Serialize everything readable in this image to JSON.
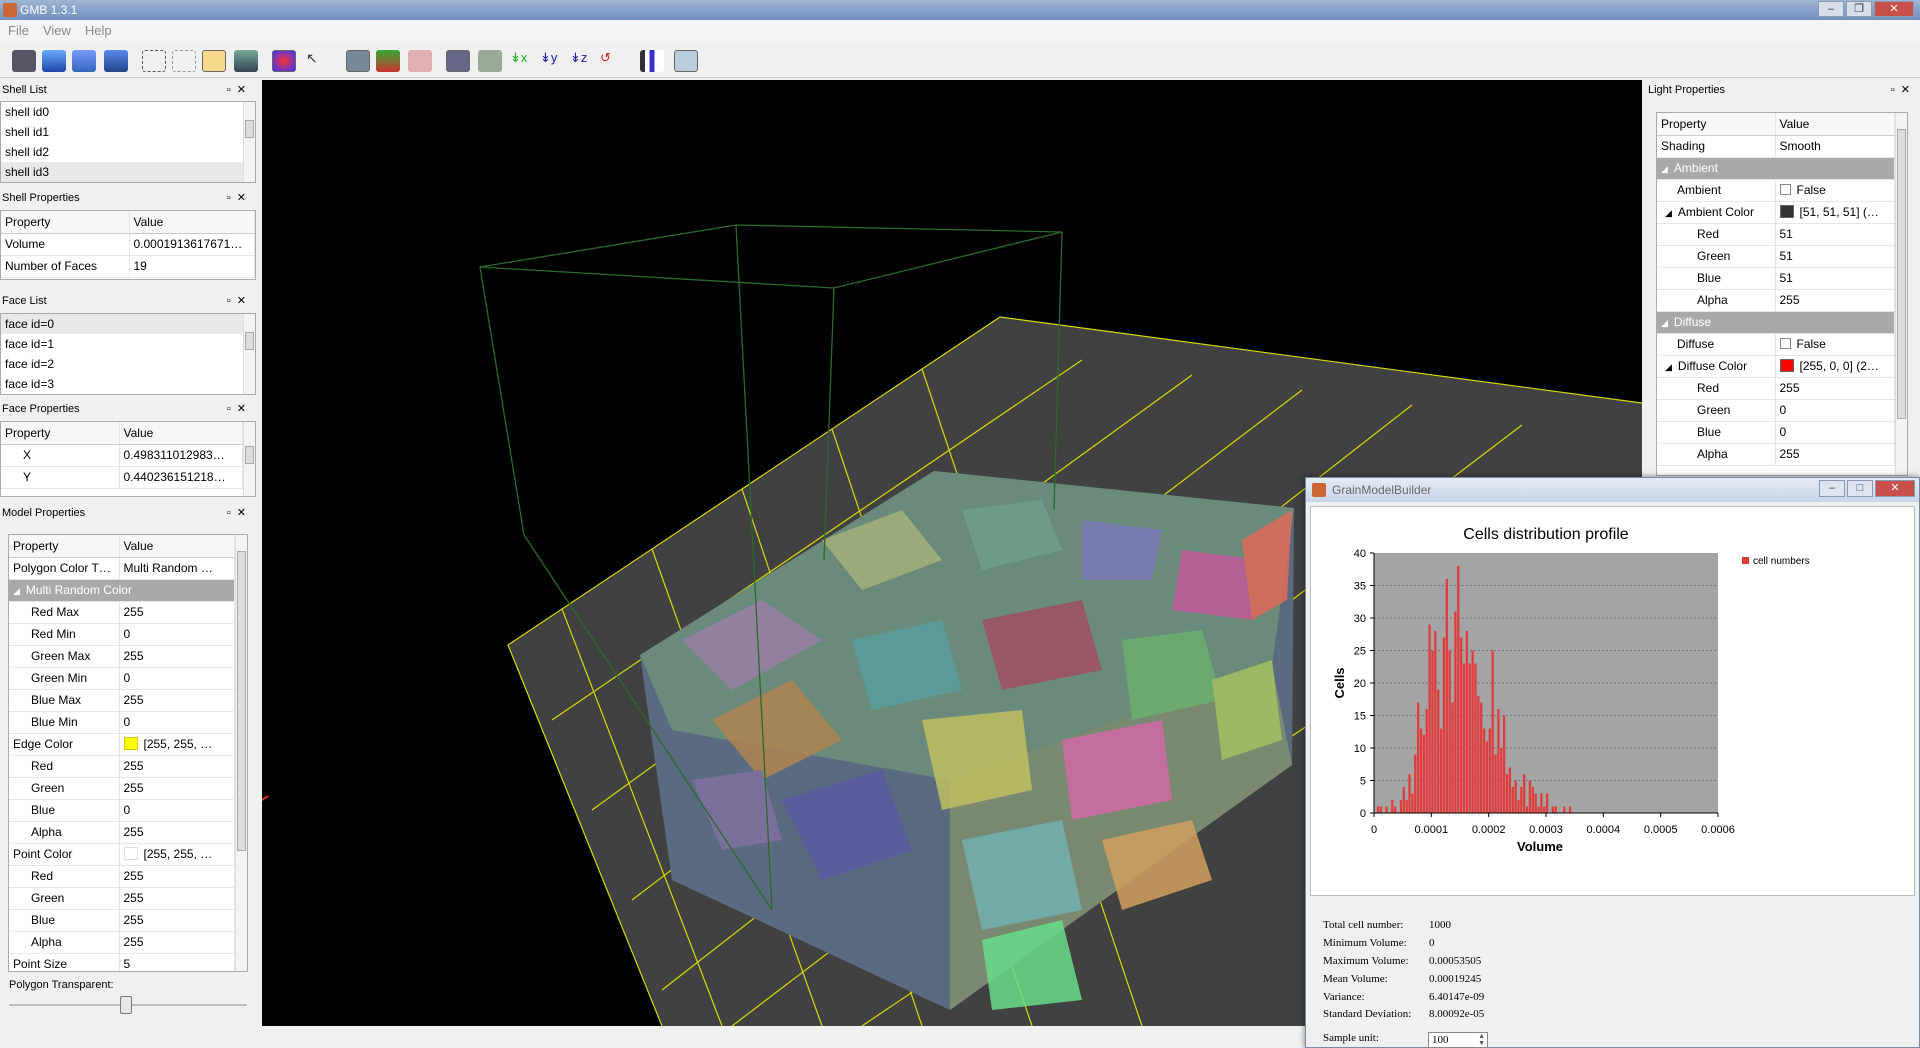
{
  "app": {
    "title": "GMB 1.3.1"
  },
  "menu": [
    "File",
    "View",
    "Help"
  ],
  "shell_list": {
    "title": "Shell List",
    "items": [
      "shell id0",
      "shell id1",
      "shell id2",
      "shell id3"
    ]
  },
  "shell_props": {
    "title": "Shell Properties",
    "header": [
      "Property",
      "Value"
    ],
    "rows": [
      [
        "Volume",
        "0.0001913617671…"
      ],
      [
        "Number of Faces",
        "19"
      ]
    ]
  },
  "face_list": {
    "title": "Face List",
    "items": [
      "face id=0",
      "face id=1",
      "face id=2",
      "face id=3"
    ]
  },
  "face_props": {
    "title": "Face Properties",
    "header": [
      "Property",
      "Value"
    ],
    "rows": [
      [
        "X",
        "0.498311012983…"
      ],
      [
        "Y",
        "0.440236151218…"
      ]
    ]
  },
  "model_props": {
    "title": "Model Properties",
    "header": [
      "Property",
      "Value"
    ],
    "polygon_color_label": "Polygon Color T…",
    "polygon_color_value": "Multi Random …",
    "group": "Multi Random Color",
    "rows": [
      [
        "Red Max",
        "255"
      ],
      [
        "Red Min",
        "0"
      ],
      [
        "Green Max",
        "255"
      ],
      [
        "Green Min",
        "0"
      ],
      [
        "Blue Max",
        "255"
      ],
      [
        "Blue Min",
        "0"
      ]
    ],
    "edge_color_label": "Edge Color",
    "edge_color_value": "[255, 255, …",
    "edge_color_hex": "#ffff00",
    "edge_rows": [
      [
        "Red",
        "255"
      ],
      [
        "Green",
        "255"
      ],
      [
        "Blue",
        "0"
      ],
      [
        "Alpha",
        "255"
      ]
    ],
    "point_color_label": "Point Color",
    "point_color_value": "[255, 255, …",
    "point_rows": [
      [
        "Red",
        "255"
      ],
      [
        "Green",
        "255"
      ],
      [
        "Blue",
        "255"
      ],
      [
        "Alpha",
        "255"
      ]
    ],
    "point_size_label": "Point Size",
    "point_size_value": "5",
    "slider_label": "Polygon Transparent:"
  },
  "light_props": {
    "title": "Light Properties",
    "header": [
      "Property",
      "Value"
    ],
    "shading_label": "Shading",
    "shading_value": "Smooth",
    "ambient_group": "Ambient",
    "ambient_label": "Ambient",
    "ambient_value": "False",
    "ambient_color_label": "Ambient Color",
    "ambient_color_value": "[51, 51, 51] (…",
    "ambient_hex": "#333333",
    "ambient_rows": [
      [
        "Red",
        "51"
      ],
      [
        "Green",
        "51"
      ],
      [
        "Blue",
        "51"
      ],
      [
        "Alpha",
        "255"
      ]
    ],
    "diffuse_group": "Diffuse",
    "diffuse_label": "Diffuse",
    "diffuse_value": "False",
    "diffuse_color_label": "Diffuse Color",
    "diffuse_color_value": "[255, 0, 0] (2…",
    "diffuse_hex": "#ff0000",
    "diffuse_rows": [
      [
        "Red",
        "255"
      ],
      [
        "Green",
        "0"
      ],
      [
        "Blue",
        "0"
      ],
      [
        "Alpha",
        "255"
      ]
    ]
  },
  "dialog": {
    "title": "GrainModelBuilder",
    "stats": [
      [
        "Total cell number:",
        "1000"
      ],
      [
        "Minimum Volume:",
        "0"
      ],
      [
        "Maximum Volume:",
        "0.00053505"
      ],
      [
        "Mean Volume:",
        "0.00019245"
      ],
      [
        "Variance:",
        "6.40147e-09"
      ],
      [
        "Standard Deviation:",
        "8.00092e-05"
      ]
    ],
    "sample_label": "Sample unit:",
    "sample_value": "100"
  },
  "chart_data": {
    "type": "bar",
    "title": "Cells distribution profile",
    "xlabel": "Volume",
    "ylabel": "Cells",
    "xlim": [
      0,
      0.0006
    ],
    "ylim": [
      0,
      40
    ],
    "xticks": [
      "0",
      "0.0001",
      "0.0002",
      "0.0003",
      "0.0004",
      "0.0005",
      "0.0006"
    ],
    "yticks": [
      "0",
      "5",
      "10",
      "15",
      "20",
      "25",
      "30",
      "35",
      "40"
    ],
    "bin_width": 5e-06,
    "grid": true,
    "legend_position": "top-right",
    "series": [
      {
        "name": "cell numbers",
        "color": "#e33a3a",
        "values": [
          0,
          1,
          1,
          0,
          1,
          0,
          2,
          1,
          0,
          2,
          4,
          2,
          6,
          3,
          9,
          17,
          13,
          12,
          16,
          29,
          25,
          28,
          19,
          13,
          27,
          36,
          25,
          17,
          31,
          38,
          27,
          23,
          28,
          23,
          25,
          23,
          18,
          17,
          13,
          11,
          13,
          25,
          9,
          16,
          10,
          15,
          6,
          7,
          4,
          5,
          2,
          4,
          6,
          1,
          5,
          4,
          3,
          1,
          3,
          1,
          3,
          0,
          1,
          1,
          0,
          0,
          1,
          0,
          1,
          0,
          0,
          0,
          0,
          0,
          0,
          0,
          0,
          0,
          0,
          0,
          0
        ]
      }
    ]
  }
}
